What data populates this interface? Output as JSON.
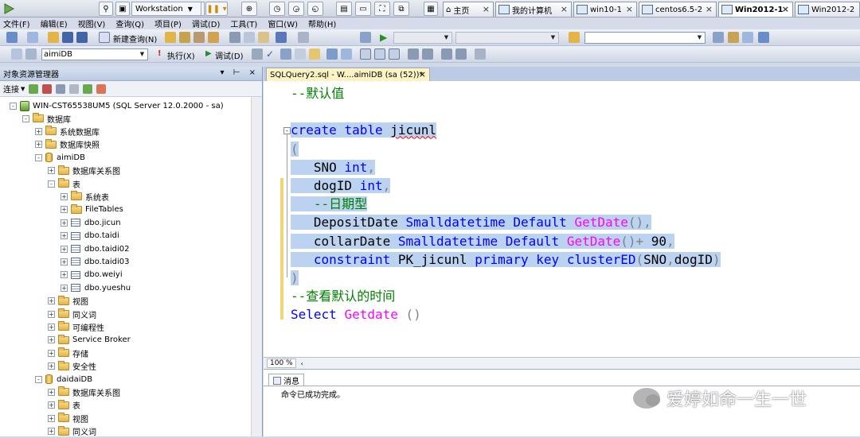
{
  "vmware": {
    "workstation_label": "Workstation",
    "tabs": [
      {
        "label": "主页",
        "active": false
      },
      {
        "label": "我的计算机",
        "active": false
      },
      {
        "label": "win10-1",
        "active": false
      },
      {
        "label": "centos6.5-2",
        "active": false
      },
      {
        "label": "Win2012-1",
        "active": true
      },
      {
        "label": "Win2012-2",
        "active": false
      }
    ]
  },
  "menu": [
    "文件(F)",
    "编辑(E)",
    "视图(V)",
    "查询(Q)",
    "项目(P)",
    "调试(D)",
    "工具(T)",
    "窗口(W)",
    "帮助(H)"
  ],
  "toolbar1": {
    "new_query": "新建查询(N)"
  },
  "toolbar2": {
    "database": "aimiDB",
    "execute": "执行(X)",
    "debug": "调试(D)"
  },
  "object_explorer": {
    "title": "对象资源管理器",
    "connect": "连接",
    "server": "WIN-CST65538UM5 (SQL Server 12.0.2000 - sa)",
    "nodes": [
      {
        "label": "数据库",
        "kind": "folder",
        "level": 1,
        "exp": "-"
      },
      {
        "label": "系统数据库",
        "kind": "folder",
        "level": 2,
        "exp": "+"
      },
      {
        "label": "数据库快照",
        "kind": "folder",
        "level": 2,
        "exp": "+"
      },
      {
        "label": "aimiDB",
        "kind": "db",
        "level": 2,
        "exp": "-"
      },
      {
        "label": "数据库关系图",
        "kind": "folder",
        "level": 3,
        "exp": "+"
      },
      {
        "label": "表",
        "kind": "folder",
        "level": 3,
        "exp": "-"
      },
      {
        "label": "系统表",
        "kind": "folder",
        "level": 4,
        "exp": "+"
      },
      {
        "label": "FileTables",
        "kind": "folder",
        "level": 4,
        "exp": "+"
      },
      {
        "label": "dbo.jicun",
        "kind": "table",
        "level": 4,
        "exp": "+"
      },
      {
        "label": "dbo.taidi",
        "kind": "table",
        "level": 4,
        "exp": "+"
      },
      {
        "label": "dbo.taidi02",
        "kind": "table",
        "level": 4,
        "exp": "+"
      },
      {
        "label": "dbo.taidi03",
        "kind": "table",
        "level": 4,
        "exp": "+"
      },
      {
        "label": "dbo.weiyi",
        "kind": "table",
        "level": 4,
        "exp": "+"
      },
      {
        "label": "dbo.yueshu",
        "kind": "table",
        "level": 4,
        "exp": "+"
      },
      {
        "label": "视图",
        "kind": "folder",
        "level": 3,
        "exp": "+"
      },
      {
        "label": "同义词",
        "kind": "folder",
        "level": 3,
        "exp": "+"
      },
      {
        "label": "可编程性",
        "kind": "folder",
        "level": 3,
        "exp": "+"
      },
      {
        "label": "Service Broker",
        "kind": "folder",
        "level": 3,
        "exp": "+"
      },
      {
        "label": "存储",
        "kind": "folder",
        "level": 3,
        "exp": "+"
      },
      {
        "label": "安全性",
        "kind": "folder",
        "level": 3,
        "exp": "+"
      },
      {
        "label": "daidaiDB",
        "kind": "db",
        "level": 2,
        "exp": "-"
      },
      {
        "label": "数据库关系图",
        "kind": "folder",
        "level": 3,
        "exp": "+"
      },
      {
        "label": "表",
        "kind": "folder",
        "level": 3,
        "exp": "+"
      },
      {
        "label": "视图",
        "kind": "folder",
        "level": 3,
        "exp": "+"
      },
      {
        "label": "同义词",
        "kind": "folder",
        "level": 3,
        "exp": "+"
      }
    ]
  },
  "editor": {
    "tab_title": "SQLQuery2.sql - W....aimiDB (sa (52))*",
    "zoom": "100 %",
    "code": [
      [
        [
          "cm",
          "--默认值"
        ]
      ],
      [],
      [
        [
          "kw",
          "create"
        ],
        [
          "",
          " "
        ],
        [
          "kw",
          "table"
        ],
        [
          "",
          " "
        ],
        [
          "squig",
          "jicunl"
        ]
      ],
      [
        [
          "gr",
          "("
        ]
      ],
      [
        [
          "",
          "   SNO "
        ],
        [
          "kw",
          "int"
        ],
        [
          "gr",
          ","
        ]
      ],
      [
        [
          "",
          "   dogID "
        ],
        [
          "kw",
          "int"
        ],
        [
          "gr",
          ","
        ]
      ],
      [
        [
          "cm",
          "   --日期型"
        ]
      ],
      [
        [
          "",
          "   DepositDate "
        ],
        [
          "kw",
          "Smalldatetime"
        ],
        [
          "",
          " "
        ],
        [
          "kw",
          "Default"
        ],
        [
          "",
          " "
        ],
        [
          "fn",
          "GetDate"
        ],
        [
          "gr",
          "(),"
        ]
      ],
      [
        [
          "",
          "   collarDate "
        ],
        [
          "kw",
          "Smalldatetime"
        ],
        [
          "",
          " "
        ],
        [
          "kw",
          "Default"
        ],
        [
          "",
          " "
        ],
        [
          "fn",
          "GetDate"
        ],
        [
          "gr",
          "()+"
        ],
        [
          "",
          " 90"
        ],
        [
          "gr",
          ","
        ]
      ],
      [
        [
          "",
          "   "
        ],
        [
          "kw",
          "constraint"
        ],
        [
          "",
          " PK_jicunl "
        ],
        [
          "kw",
          "primary"
        ],
        [
          "",
          " "
        ],
        [
          "kw",
          "key"
        ],
        [
          "",
          " "
        ],
        [
          "kw",
          "clusterED"
        ],
        [
          "gr",
          "("
        ],
        [
          "",
          "SNO"
        ],
        [
          "gr",
          ","
        ],
        [
          "",
          "dogID"
        ],
        [
          "gr",
          ")"
        ]
      ],
      [
        [
          "gr",
          ")"
        ]
      ],
      [
        [
          "cm",
          "--查看默认的时间"
        ]
      ],
      [
        [
          "kw",
          "Select"
        ],
        [
          "",
          " "
        ],
        [
          "fn",
          "Getdate"
        ],
        [
          "",
          " "
        ],
        [
          "gr",
          "()"
        ]
      ]
    ]
  },
  "results": {
    "tab": "消息",
    "message": "命令已成功完成。"
  },
  "watermark": "爱婷如命一生一世"
}
